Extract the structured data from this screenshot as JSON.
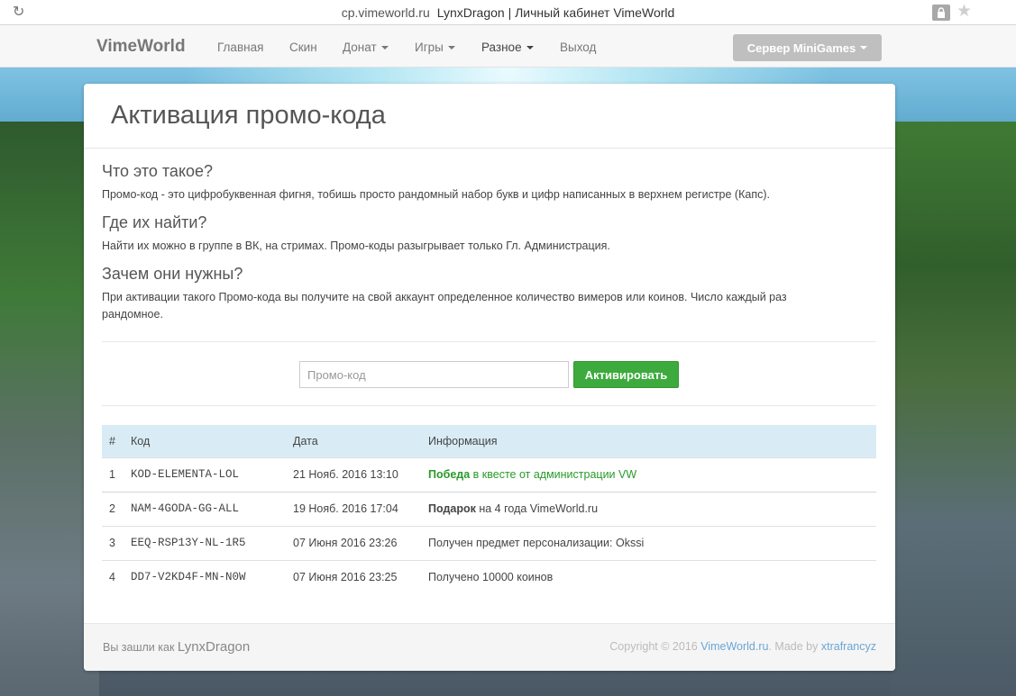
{
  "browser": {
    "domain": "cp.vimeworld.ru",
    "title": "LynxDragon | Личный кабинет VimeWorld"
  },
  "navbar": {
    "brand": "VimeWorld",
    "items": [
      {
        "label": "Главная"
      },
      {
        "label": "Скин"
      },
      {
        "label": "Донат"
      },
      {
        "label": "Игры"
      },
      {
        "label": "Разное"
      },
      {
        "label": "Выход"
      }
    ],
    "server_button": "Сервер MiniGames"
  },
  "panel": {
    "title": "Активация промо-кода",
    "faq": [
      {
        "question": "Что это такое?",
        "answer": "Промо-код - это цифробуквенная фигня, тобишь просто рандомный набор букв и цифр написанных в верхнем регистре (Капс)."
      },
      {
        "question": "Где их найти?",
        "answer": "Найти их можно в группе в ВК, на стримах. Промо-коды разыгрывает только Гл. Администрация."
      },
      {
        "question": "Зачем они нужны?",
        "answer": "При активации такого Промо-кода вы получите на свой аккаунт определенное количество вимеров или коинов. Число каждый раз рандомное."
      }
    ],
    "promo_input": {
      "placeholder": "Промо-код",
      "value": ""
    },
    "activate_button": "Активировать",
    "table": {
      "headers": {
        "num": "#",
        "code": "Код",
        "date": "Дата",
        "info": "Информация"
      },
      "rows": [
        {
          "num": "1",
          "code": "KOD-ELEMENTA-LOL",
          "date": "21 Нояб. 2016 13:10",
          "info_bold": "Победа",
          "info_rest": " в квесте от администрации VW",
          "info_color": "#2a9a2a"
        },
        {
          "num": "2",
          "code": "NAM-4GODA-GG-ALL",
          "date": "19 Нояб. 2016 17:04",
          "info_bold": "Подарок",
          "info_rest": " на 4 года VimeWorld.ru",
          "info_color": "#444444"
        },
        {
          "num": "3",
          "code": "EEQ-RSP13Y-NL-1R5",
          "date": "07 Июня 2016 23:26",
          "info_bold": "",
          "info_rest": "Получен предмет персонализации: Okssi",
          "info_color": "#444444"
        },
        {
          "num": "4",
          "code": "DD7-V2KD4F-MN-N0W",
          "date": "07 Июня 2016 23:25",
          "info_bold": "",
          "info_rest": "Получено 10000 коинов",
          "info_color": "#444444"
        }
      ]
    }
  },
  "footer": {
    "logged_prefix": "Вы зашли как",
    "username": "LynxDragon",
    "copyright_prefix": "Copyright © 2016",
    "site_link": "VimeWorld.ru",
    "made_by_prefix": ". Made by",
    "author_link": "xtrafrancyz"
  },
  "colors": {
    "activate_button": "#3daa3d",
    "table_header": "#d9ecf5",
    "server_button": "#bfbfbf",
    "link": "#6aa6d6"
  }
}
